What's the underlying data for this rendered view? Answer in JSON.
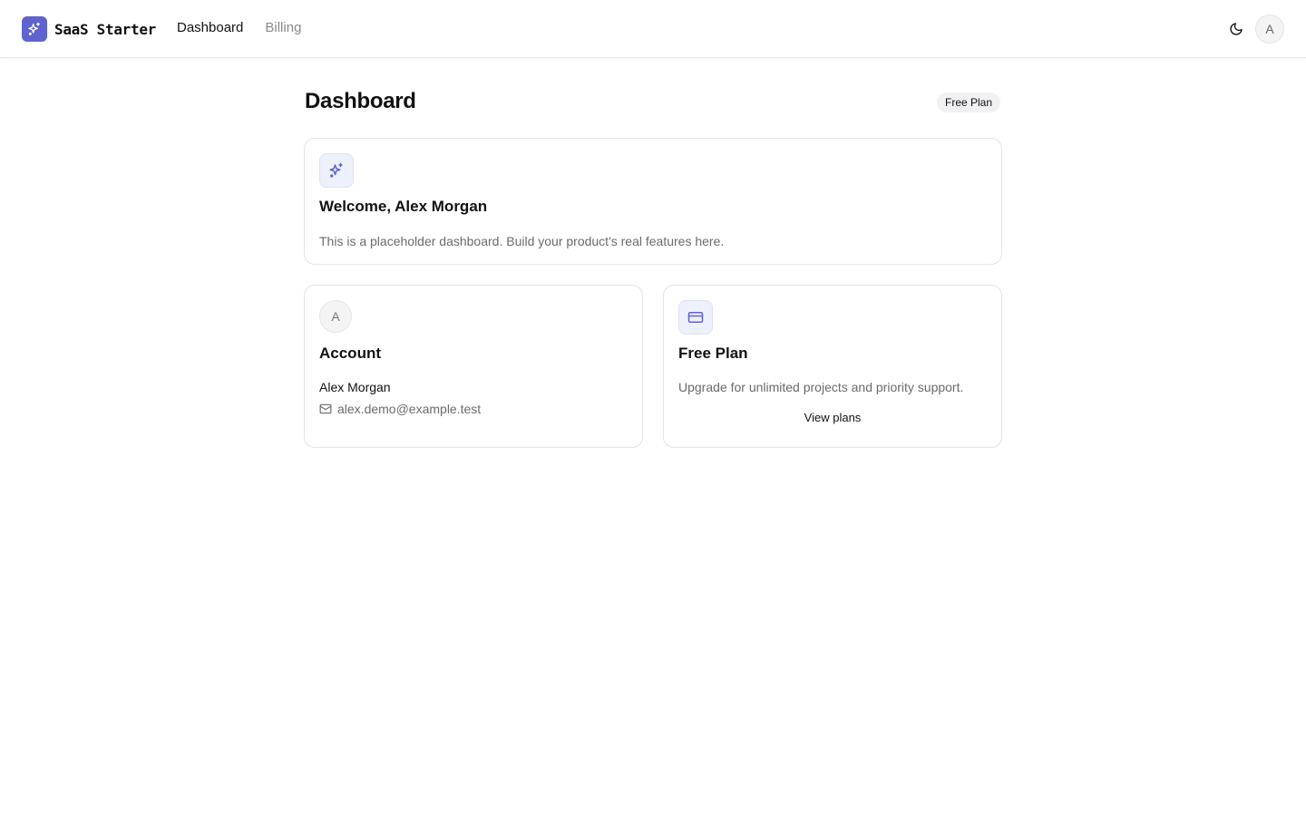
{
  "header": {
    "brand_name": "SaaS Starter",
    "brand_color": "#5f63cd",
    "nav": [
      {
        "label": "Dashboard",
        "active": true
      },
      {
        "label": "Billing",
        "active": false
      }
    ],
    "avatar_initial": "A"
  },
  "page": {
    "title": "Dashboard",
    "plan_badge": "Free Plan"
  },
  "welcome_card": {
    "icon": "sparkles-icon",
    "title": "Welcome, Alex Morgan",
    "description": "This is a placeholder dashboard. Build your product's real features here."
  },
  "account_card": {
    "avatar_initial": "A",
    "title": "Account",
    "name": "Alex Morgan",
    "email": "alex.demo@example.test"
  },
  "plan_card": {
    "icon": "credit-card-icon",
    "title": "Free Plan",
    "description": "Upgrade for unlimited projects and priority support.",
    "cta": "View plans"
  }
}
